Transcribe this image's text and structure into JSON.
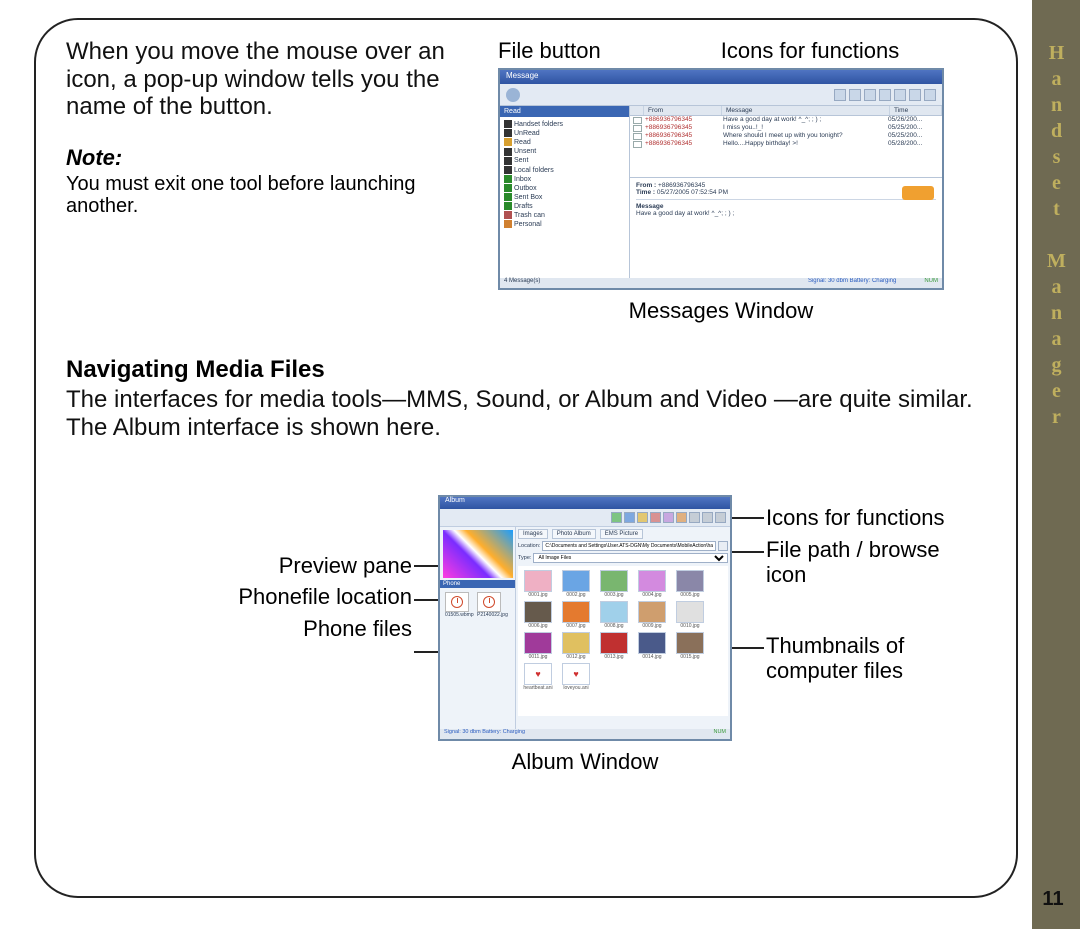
{
  "sidebar": {
    "title": "Handset Manager"
  },
  "page_number": "11",
  "intro_paragraph": "When you move the mouse over an icon, a pop-up window tells you the name of the button.",
  "note": {
    "heading": "Note:",
    "body": "You must exit one tool before launching another."
  },
  "section_heading": "Navigating Media Files",
  "section_body": "The interfaces for media tools—MMS, Sound, or Album and Video —are quite similar. The Album interface is shown here.",
  "messages": {
    "callout_file": "File button",
    "callout_icons": "Icons for functions",
    "caption": "Messages Window",
    "title": "Message",
    "tree_header": "Read",
    "tree": [
      "Handset folders",
      "UnRead",
      "Read",
      "Unsent",
      "Sent",
      "Local folders",
      "Inbox",
      "Outbox",
      "Sent Box",
      "Drafts",
      "Trash can",
      "Personal"
    ],
    "cols": [
      "",
      "From",
      "Message",
      "Time"
    ],
    "rows": [
      {
        "from": "+886936796345",
        "msg": "Have a good day at work! ^_^; ; ) ;",
        "time": "05/26/200..."
      },
      {
        "from": "+886936796345",
        "msg": "I miss you..!_!",
        "time": "05/25/200..."
      },
      {
        "from": "+886936796345",
        "msg": "Where should I meet up with you tonight?",
        "time": "05/25/200..."
      },
      {
        "from": "+886936796345",
        "msg": "Hello....Happy birthday! >!",
        "time": "05/28/200..."
      }
    ],
    "preview": {
      "from_label": "From :",
      "from": "+886936796345",
      "time_label": "Time :",
      "time": "05/27/2005 07:52:54 PM",
      "msg_label": "Message",
      "msg": "Have a good day at work! ^_^; ; ) ;"
    },
    "status_left": "4 Message(s)",
    "status_right": "Signal: 30 dbm Battery: Charging",
    "status_badge": "NUM"
  },
  "album": {
    "labels_left": [
      "Preview pane",
      "Phonefile location",
      "Phone  files"
    ],
    "labels_right": [
      "Icons for functions",
      "File path / browse icon",
      "Thumbnails of computer files"
    ],
    "caption": "Album Window",
    "title": "Album",
    "tabs": [
      "Images",
      "Photo Album",
      "EMS Picture"
    ],
    "location_label": "Location:",
    "location_path": "C:\\Documents and Settings\\User.ATS-DGN\\My Documents\\MobileAction\\hand...",
    "type_label": "Type:",
    "type_value": "All Image Files",
    "phone_header": "Phone",
    "phone_files": [
      "01505.wbmp",
      "P2140022.jpg"
    ],
    "bottom_files": [
      "heartbeat.ani",
      "loveyou.ani"
    ],
    "grid": [
      {
        "n": "0001.jpg",
        "c": "#efb0c4"
      },
      {
        "n": "0002.jpg",
        "c": "#6aa5e4"
      },
      {
        "n": "0003.jpg",
        "c": "#79b66f"
      },
      {
        "n": "0004.jpg",
        "c": "#d38adf"
      },
      {
        "n": "0005.jpg",
        "c": "#8a87a8"
      },
      {
        "n": "0006.jpg",
        "c": "#665a4c"
      },
      {
        "n": "0007.jpg",
        "c": "#e47a2f"
      },
      {
        "n": "0008.jpg",
        "c": "#a0d0ea"
      },
      {
        "n": "0009.jpg",
        "c": "#cf9e6e"
      },
      {
        "n": "0010.jpg",
        "c": "#e0e0e0"
      },
      {
        "n": "0011.jpg",
        "c": "#a03a9a"
      },
      {
        "n": "0012.jpg",
        "c": "#e0c060"
      },
      {
        "n": "0013.jpg",
        "c": "#c03030"
      },
      {
        "n": "0014.jpg",
        "c": "#4a5a8a"
      },
      {
        "n": "0015.jpg",
        "c": "#8a705a"
      }
    ],
    "status": "Signal: 30 dbm Battery: Charging",
    "status_badge": "NUM"
  }
}
